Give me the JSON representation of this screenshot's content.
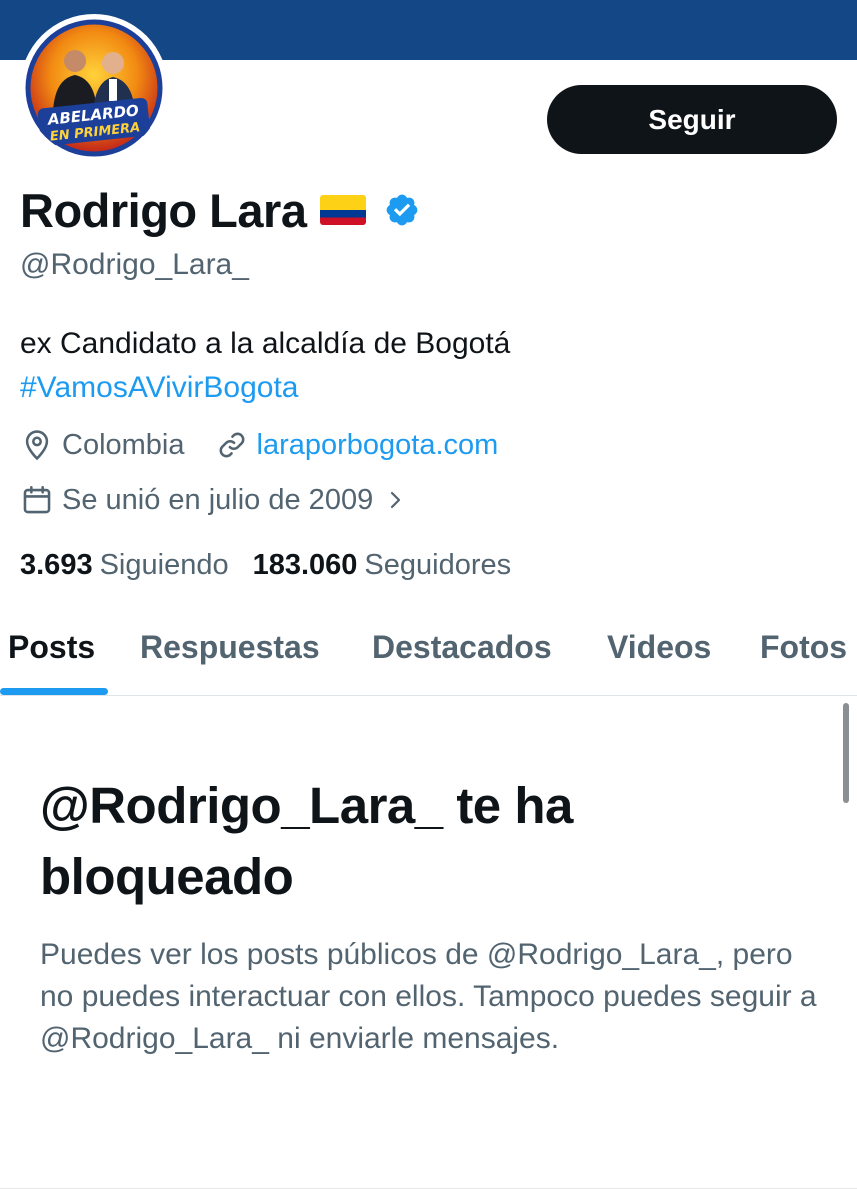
{
  "profile": {
    "avatar_text_line1": "ABELARDO",
    "avatar_text_line2": "EN PRIMERA",
    "follow_label": "Seguir",
    "display_name": "Rodrigo Lara",
    "handle": "@Rodrigo_Lara_",
    "bio": "ex Candidato a la alcaldía de Bogotá",
    "hashtag": "#VamosAVivirBogota",
    "location": "Colombia",
    "website": "laraporbogota.com",
    "joined": "Se unió en julio de 2009",
    "following_count": "3.693",
    "following_label": "Siguiendo",
    "followers_count": "183.060",
    "followers_label": "Seguidores"
  },
  "tabs": [
    {
      "label": "Posts",
      "active": true
    },
    {
      "label": "Respuestas",
      "active": false
    },
    {
      "label": "Destacados",
      "active": false
    },
    {
      "label": "Videos",
      "active": false
    },
    {
      "label": "Fotos",
      "active": false
    }
  ],
  "blocked": {
    "title": "@Rodrigo_Lara_ te ha bloqueado",
    "description": "Puedes ver los posts públicos de @Rodrigo_Lara_, pero no puedes interactuar con ellos. Tampoco puedes seguir a @Rodrigo_Lara_ ni enviarle mensajes."
  },
  "icons": {
    "location": "location-pin-icon",
    "link": "link-icon",
    "calendar": "calendar-icon",
    "verified": "verified-badge-icon",
    "flag": "colombia-flag-icon"
  },
  "colors": {
    "banner": "#134785",
    "accent": "#1d9bf0",
    "text_primary": "#0f1419",
    "text_secondary": "#536471",
    "button_bg": "#0f1419"
  }
}
